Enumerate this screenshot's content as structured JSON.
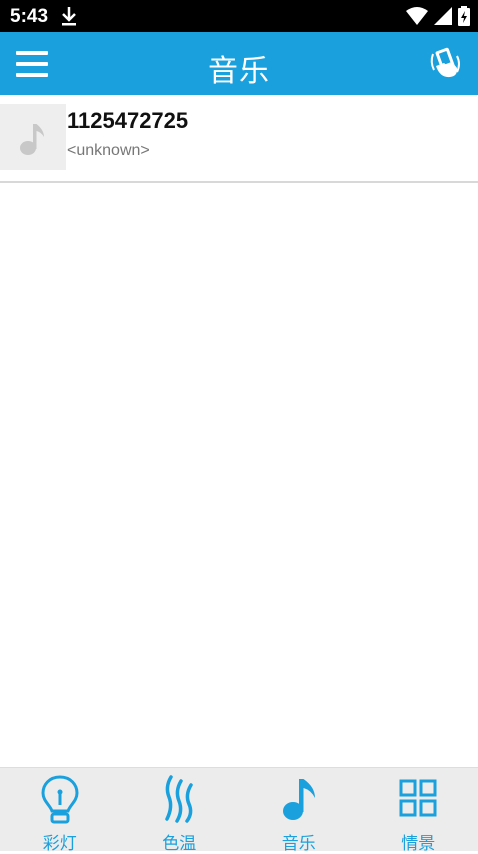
{
  "status_bar": {
    "time": "5:43",
    "icons": [
      "download-icon",
      "wifi-icon",
      "signal-icon",
      "battery-charging-icon"
    ]
  },
  "app_bar": {
    "title": "音乐",
    "left_icon": "menu-icon",
    "right_icon": "shake-phone-icon"
  },
  "songs": [
    {
      "title": "1125472725",
      "artist": "<unknown>",
      "icon": "music-note-icon"
    }
  ],
  "bottom_nav": [
    {
      "label": "彩灯",
      "icon": "bulb-icon",
      "active": false
    },
    {
      "label": "色温",
      "icon": "flame-icon",
      "active": false
    },
    {
      "label": "音乐",
      "icon": "music-note-icon",
      "active": true
    },
    {
      "label": "情景",
      "icon": "grid-icon",
      "active": false
    }
  ],
  "colors": {
    "accent": "#1aa0dd",
    "status_bar": "#000000",
    "nav_bg": "#ececec"
  }
}
